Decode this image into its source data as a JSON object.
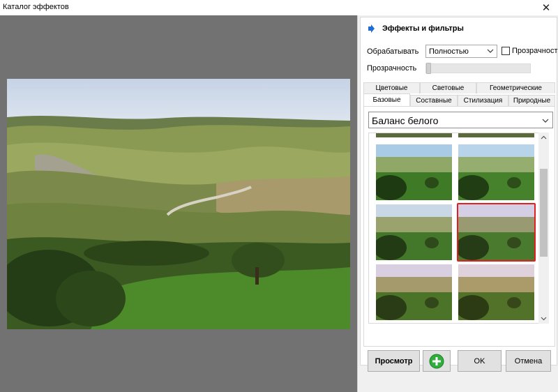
{
  "window": {
    "title": "Каталог эффектов",
    "close_symbol": "✕"
  },
  "panel": {
    "header_title": "Эффекты и фильтры",
    "process_label": "Обрабатывать",
    "process_value": "Полностью",
    "transparency_checkbox_label": "Прозрачность",
    "transparency_checked": false,
    "transparency_label": "Прозрачность",
    "transparency_level": 0
  },
  "tabs_row1": [
    "Цветовые",
    "Световые",
    "Геометрические"
  ],
  "tabs_row2": [
    "Базовые",
    "Составные",
    "Стилизация",
    "Природные"
  ],
  "active_tab": "Базовые",
  "effect_select": "Баланс белого",
  "gallery": {
    "selected_index": 3,
    "count_visible": 6
  },
  "buttons": {
    "preview": "Просмотр",
    "ok": "OK",
    "cancel": "Отмена"
  },
  "colors": {
    "selection": "#e02020",
    "add_icon": "#2fae3c",
    "arrow": "#1e6fd0"
  },
  "icons": {
    "header": "arrow-right-icon",
    "add": "plus-circle-icon",
    "close": "close-icon"
  }
}
